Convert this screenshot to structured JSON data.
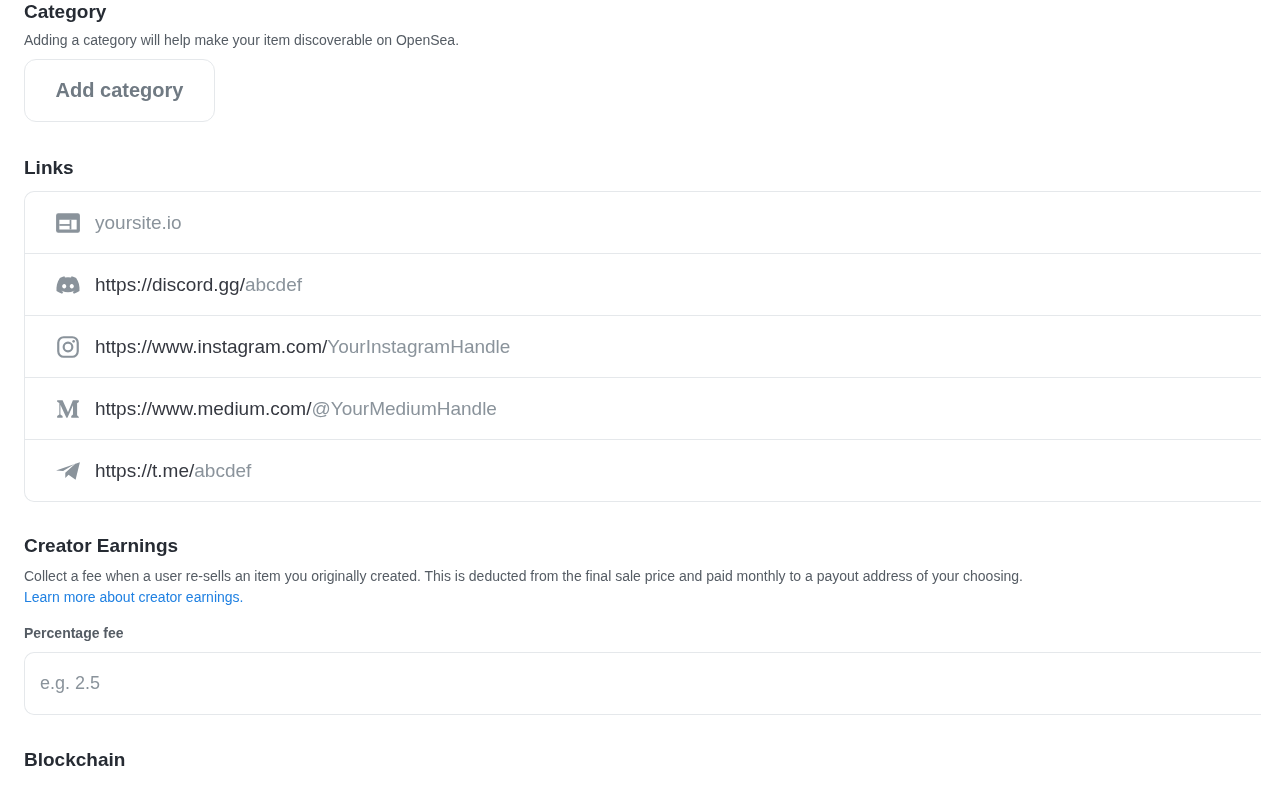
{
  "sections": [
    {
      "kind": "category",
      "title": "Category",
      "description": "Adding a category will help make your item discoverable on OpenSea.",
      "button": "Add category"
    },
    {
      "kind": "links",
      "title": "Links",
      "links": [
        {
          "kind": "website",
          "placeholder": "yoursite.io"
        },
        {
          "kind": "discord",
          "prefix": "https://discord.gg/",
          "placeholder": "abcdef"
        },
        {
          "kind": "instagram",
          "prefix": "https://www.instagram.com/",
          "placeholder": "YourInstagramHandle"
        },
        {
          "kind": "medium",
          "prefix": "https://www.medium.com/",
          "placeholder": "@YourMediumHandle"
        },
        {
          "kind": "telegram",
          "prefix": "https://t.me/",
          "placeholder": "abcdef"
        }
      ]
    },
    {
      "kind": "earnings",
      "title": "Creator Earnings",
      "description": "Collect a fee when a user re-sells an item you originally created. This is deducted from the final sale price and paid monthly to a payout address of your choosing.",
      "link": "Learn more about creator earnings.",
      "field_label": "Percentage fee",
      "placeholder": "e.g. 2.5"
    },
    {
      "kind": "heading",
      "title": "Blockchain"
    }
  ]
}
